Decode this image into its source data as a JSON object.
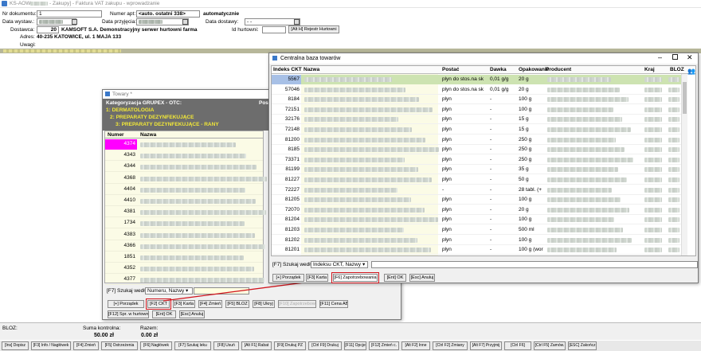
{
  "titlebar": {
    "app": "KS-AOW",
    "title": "- Zakupy] - Faktura VAT zakupu - wprowadzanie"
  },
  "form": {
    "nr_dokumentu_label": "Nr dokumentu:",
    "nr_dokumentu": "1",
    "nr_apt_label": "Numer apt:",
    "nr_apt": "<auto. ostatni 338>",
    "nr_apt_mode": "automatycznie",
    "data_wyst_label": "Data wystaw.:",
    "data_przyj_label": "Data przyjęcia:",
    "data_dost_label": "Data dostawy:",
    "data_dost": "- -",
    "dostawca_label": "Dostawca:",
    "dostawca_nr": "20",
    "dostawca_name": "KAMSOFT S.A. Demonstracyjny serwer hurtowni farma",
    "id_hurt_label": "Id hurtowni:",
    "rejestr_btn": "[Alt H] Rejestr Hurtowni",
    "adres_label": "Adres:",
    "adres": "40-235 KATOWICE, ul. 1 MAJA 133",
    "uwagi_label": "Uwagi:"
  },
  "towary": {
    "title": "Towary *",
    "header_line": "Kategoryzacja GRUPEX - OTC:",
    "cat1": "1: DERMATOLOGIA",
    "cat2": "2: PREPARATY DEZYNFEKUJĄCE",
    "cat3": "3: PREPARATY DEZYNFEKUJĄCE - RANY",
    "pos_label": "Pos",
    "col_numer": "Numer",
    "col_nazwa": "Nazwa",
    "numbers": [
      "4374",
      "4343",
      "4344",
      "4368",
      "4404",
      "4410",
      "4381",
      "1734",
      "4383",
      "4366",
      "1851",
      "4352",
      "4377"
    ],
    "search_label": "[F7] Szukaj według:",
    "search_value": "Numeru, Nazwy",
    "buttons_row1": [
      "[+] Porządek",
      "[F2] CKT",
      "[F3] Karta",
      "[F4] Zmień",
      "[F5] BLOZ",
      "[F8] Ukryj",
      "[F10] Zapotrzebowania",
      "[F11] Cena ABD"
    ],
    "buttons_row2": [
      "[F12] Spr. w hurtowni",
      "[Ent] OK",
      "[Esc] Anuluj"
    ]
  },
  "ckt": {
    "title": "Centralna baza towarów",
    "columns": [
      "Indeks CKT",
      "Nazwa",
      "Postać",
      "Dawka",
      "Opakowanie",
      "Producent",
      "Kraj",
      "BLOZ"
    ],
    "rows": [
      {
        "idx": "5567",
        "postac": "plyn do stos.na sk",
        "dawka": "0,01 g/g",
        "opak": "20 g"
      },
      {
        "idx": "57046",
        "postac": "plyn do stos.na sk",
        "dawka": "0,01 g/g",
        "opak": "20 g"
      },
      {
        "idx": "8184",
        "postac": "plyn",
        "dawka": "-",
        "opak": "100 g"
      },
      {
        "idx": "72151",
        "postac": "plyn",
        "dawka": "-",
        "opak": "100 g"
      },
      {
        "idx": "32176",
        "postac": "plyn",
        "dawka": "-",
        "opak": "15 g"
      },
      {
        "idx": "72148",
        "postac": "plyn",
        "dawka": "-",
        "opak": "15 g"
      },
      {
        "idx": "81200",
        "postac": "plyn",
        "dawka": "-",
        "opak": "250 g"
      },
      {
        "idx": "8185",
        "postac": "plyn",
        "dawka": "-",
        "opak": "250 g"
      },
      {
        "idx": "73371",
        "postac": "plyn",
        "dawka": "-",
        "opak": "250 g"
      },
      {
        "idx": "81199",
        "postac": "plyn",
        "dawka": "-",
        "opak": "35 g"
      },
      {
        "idx": "81227",
        "postac": "plyn",
        "dawka": "-",
        "opak": "50 g"
      },
      {
        "idx": "72227",
        "postac": "-",
        "dawka": "-",
        "opak": "28 tabl. (+"
      },
      {
        "idx": "81205",
        "postac": "plyn",
        "dawka": "-",
        "opak": "100 g"
      },
      {
        "idx": "72070",
        "postac": "plyn",
        "dawka": "-",
        "opak": "20 g"
      },
      {
        "idx": "81204",
        "postac": "plyn",
        "dawka": "-",
        "opak": "100 g"
      },
      {
        "idx": "81203",
        "postac": "plyn",
        "dawka": "-",
        "opak": "500 ml"
      },
      {
        "idx": "81202",
        "postac": "plyn",
        "dawka": "-",
        "opak": "100 g"
      },
      {
        "idx": "81201",
        "postac": "plyn",
        "dawka": "-",
        "opak": "100 g (wor"
      }
    ],
    "search_label": "[F7] Szukaj według:",
    "search_value": "Indeksu CKT, Nazwy",
    "buttons": [
      "[+] Porządek",
      "[F3] Karta",
      "[F6] Zapotrzebowania",
      "[Ent] OK",
      "[Esc] Anuluj"
    ]
  },
  "status": {
    "bloz_label": "BLOZ:",
    "suma_label": "Suma kontrolna:",
    "suma": "50.00 zł",
    "razem_label": "Razem:",
    "razem": "0.00 zł"
  },
  "fkeys": [
    "[Ins] Dopisz",
    "[F3] Info / Nagłówek",
    "[F4] Zmień",
    "[F5] Ostrzeżenia",
    "[F6] Nagłówek",
    "[F7] Szukaj leku",
    "[F8] Usuń",
    "[Alt F1] Rabat",
    "[F9] Drukuj PZ",
    "[Ctrl F9] Drukuj",
    "[F11] Opcje",
    "[F12] Zmień c.",
    "[Alt F2] Inne",
    "[Ctrl F2] Zmiany",
    "[Alt F7] Przyjmij",
    "[Ctrl F6]",
    "[Ctrl F5] Zamów.",
    "[ESC] Zakończ"
  ],
  "colors": {
    "title_bg": "#dce4ee",
    "towary_header_bg": "#6d6d6d",
    "cat_yellow": "#f2e837",
    "selected_row": "#ff00ff",
    "ckt_selected": "#cde3b1",
    "accent_red": "#d0141c"
  }
}
